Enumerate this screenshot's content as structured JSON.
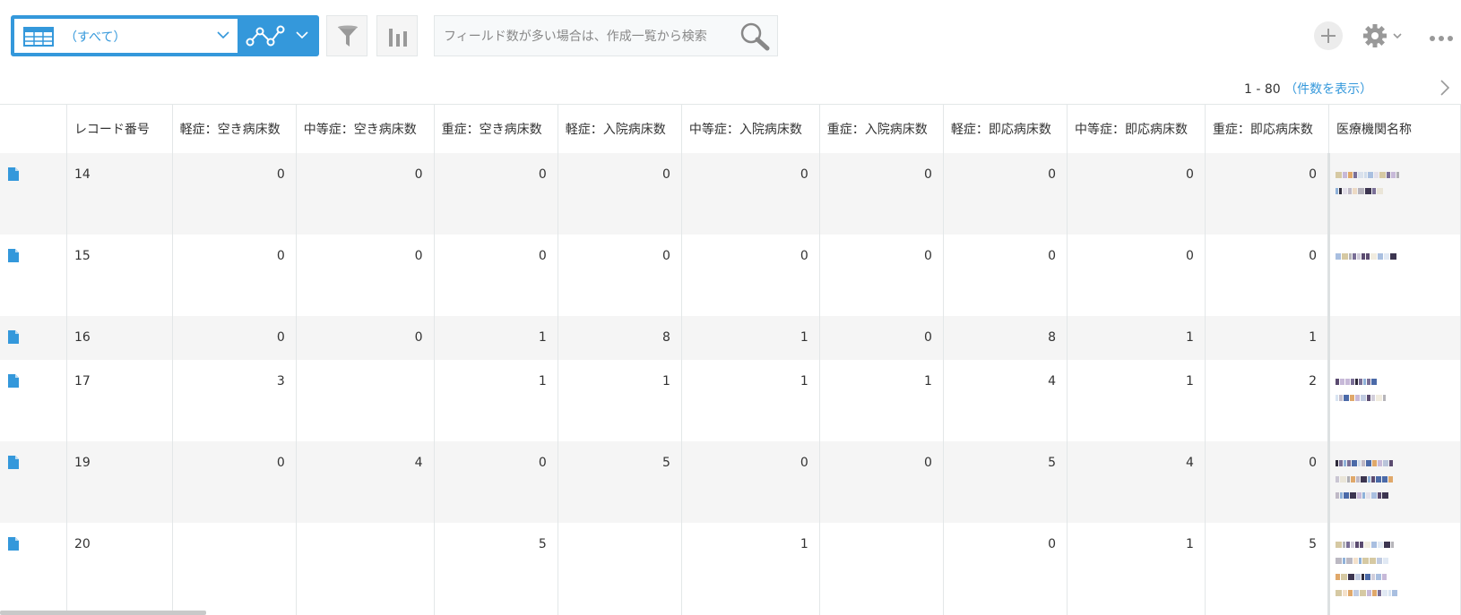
{
  "toolbar": {
    "view_label": "（すべて）",
    "search_placeholder": "フィールド数が多い場合は、作成一覧から検索",
    "icons": {
      "view": "table-grid-icon",
      "graph": "line-graph-icon",
      "filter": "funnel-icon",
      "chart": "bar-chart-icon",
      "search": "magnifier-icon",
      "add": "plus-icon",
      "settings": "gear-icon",
      "more": "ellipsis-icon"
    }
  },
  "pager": {
    "range": "1 - 80",
    "count_link": "（件数を表示）"
  },
  "colors": {
    "accent": "#3498db",
    "row_alt": "#f5f5f5",
    "border": "#e3e7e8"
  },
  "table": {
    "columns": [
      "",
      "レコード番号",
      "軽症：空き病床数",
      "中等症：空き病床数",
      "重症：空き病床数",
      "軽症：入院病床数",
      "中等症：入院病床数",
      "重症：入院病床数",
      "軽症：即応病床数",
      "中等症：即応病床数",
      "重症：即応病床数",
      "医療機関名称"
    ],
    "rows": [
      {
        "id": "14",
        "values": [
          "0",
          "0",
          "0",
          "0",
          "0",
          "0",
          "0",
          "0",
          "0"
        ]
      },
      {
        "id": "15",
        "values": [
          "0",
          "0",
          "0",
          "0",
          "0",
          "0",
          "0",
          "0",
          "0"
        ]
      },
      {
        "id": "16",
        "values": [
          "0",
          "0",
          "1",
          "8",
          "1",
          "0",
          "8",
          "1",
          "1"
        ]
      },
      {
        "id": "17",
        "values": [
          "3",
          "",
          "1",
          "1",
          "1",
          "1",
          "4",
          "1",
          "2"
        ]
      },
      {
        "id": "19",
        "values": [
          "0",
          "4",
          "0",
          "5",
          "0",
          "0",
          "5",
          "4",
          "0"
        ]
      },
      {
        "id": "20",
        "values": [
          "",
          "",
          "5",
          "",
          "1",
          "",
          "0",
          "1",
          "5"
        ]
      }
    ]
  }
}
